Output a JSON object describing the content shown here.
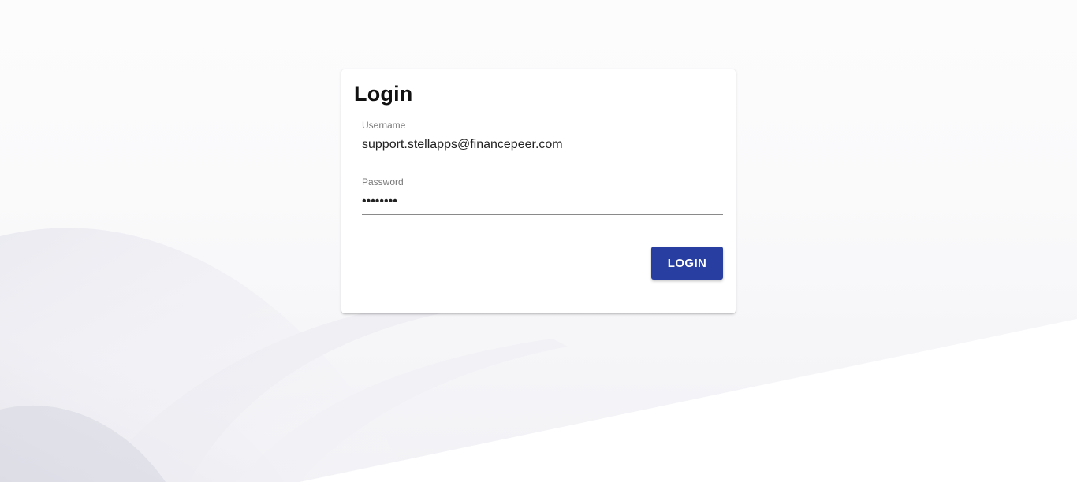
{
  "login": {
    "title": "Login",
    "username": {
      "label": "Username",
      "value": "support.stellapps@financepeer.com"
    },
    "password": {
      "label": "Password",
      "value": "12345678"
    },
    "submit_label": "LOGIN"
  },
  "colors": {
    "button": "#283ea0",
    "background": "#f6f6f9"
  }
}
